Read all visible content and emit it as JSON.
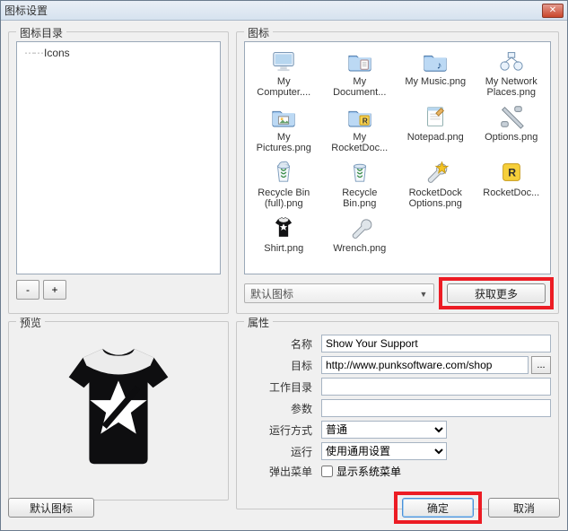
{
  "window": {
    "title": "图标设置"
  },
  "icondir": {
    "legend": "图标目录",
    "tree_root": "Icons",
    "btn_minus": "-",
    "btn_plus": "+"
  },
  "icons": {
    "legend": "图标",
    "default_combo": "默认图标",
    "get_more": "获取更多",
    "items": [
      {
        "id": "my-computer",
        "label": "My Computer....",
        "kind": "monitor"
      },
      {
        "id": "my-documents",
        "label": "My Document...",
        "kind": "folder-doc"
      },
      {
        "id": "my-music",
        "label": "My Music.png",
        "kind": "folder-music"
      },
      {
        "id": "my-network",
        "label": "My Network Places.png",
        "kind": "network"
      },
      {
        "id": "my-pictures",
        "label": "My Pictures.png",
        "kind": "folder-pic"
      },
      {
        "id": "my-rocketdock",
        "label": "My RocketDoc...",
        "kind": "folder-r"
      },
      {
        "id": "notepad",
        "label": "Notepad.png",
        "kind": "notepad"
      },
      {
        "id": "options",
        "label": "Options.png",
        "kind": "options"
      },
      {
        "id": "recycle-full",
        "label": "Recycle Bin (full).png",
        "kind": "bin-full"
      },
      {
        "id": "recycle-empty",
        "label": "Recycle Bin.png",
        "kind": "bin-empty"
      },
      {
        "id": "rocket-options",
        "label": "RocketDock Options.png",
        "kind": "wrench-star"
      },
      {
        "id": "rocketdock",
        "label": "RocketDoc...",
        "kind": "r-badge"
      },
      {
        "id": "shirt",
        "label": "Shirt.png",
        "kind": "shirt"
      },
      {
        "id": "wrench",
        "label": "Wrench.png",
        "kind": "wrench"
      }
    ]
  },
  "preview": {
    "legend": "预览"
  },
  "attrs": {
    "legend": "属性",
    "labels": {
      "name": "名称",
      "target": "目标",
      "workdir": "工作目录",
      "args": "参数",
      "runmode": "运行方式",
      "run": "运行",
      "popup": "弹出菜单"
    },
    "values": {
      "name": "Show Your Support",
      "target": "http://www.punksoftware.com/shop",
      "workdir": "",
      "args": "",
      "runmode": "普通",
      "run": "使用通用设置",
      "popup_label": "显示系统菜单",
      "popup_checked": false
    }
  },
  "buttons": {
    "default_icon": "默认图标",
    "ok": "确定",
    "cancel": "取消",
    "browse": "..."
  }
}
